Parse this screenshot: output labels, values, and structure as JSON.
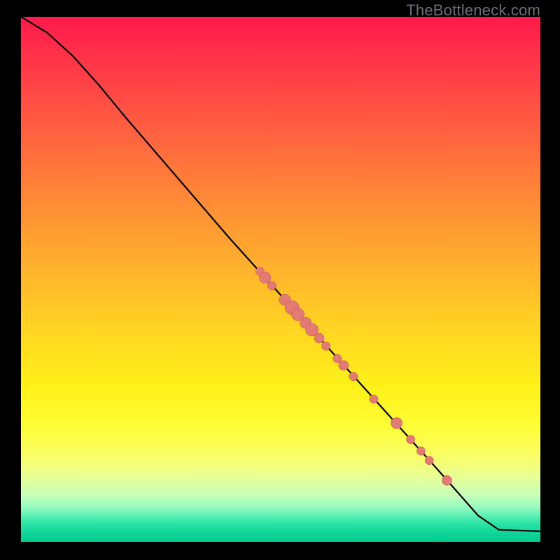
{
  "watermark": "TheBottleneck.com",
  "colors": {
    "background": "#000000",
    "line": "#000000",
    "point_fill": "#e47a74",
    "point_stroke": "#c65b58",
    "watermark": "#6b6e74"
  },
  "chart_data": {
    "type": "line",
    "title": "",
    "xlabel": "",
    "ylabel": "",
    "xlim": [
      0,
      100
    ],
    "ylim": [
      0,
      100
    ],
    "grid": false,
    "line": [
      {
        "x": 0,
        "y": 100
      },
      {
        "x": 5,
        "y": 97
      },
      {
        "x": 10,
        "y": 92.5
      },
      {
        "x": 15,
        "y": 87
      },
      {
        "x": 20,
        "y": 81
      },
      {
        "x": 30,
        "y": 69.5
      },
      {
        "x": 40,
        "y": 58
      },
      {
        "x": 50,
        "y": 47
      },
      {
        "x": 60,
        "y": 36
      },
      {
        "x": 70,
        "y": 25
      },
      {
        "x": 80,
        "y": 14
      },
      {
        "x": 88,
        "y": 5
      },
      {
        "x": 92,
        "y": 2.3
      },
      {
        "x": 100,
        "y": 2
      }
    ],
    "points": [
      {
        "x": 46.0,
        "y": 51.5,
        "size": 6
      },
      {
        "x": 47.0,
        "y": 50.3,
        "size": 8
      },
      {
        "x": 48.3,
        "y": 48.8,
        "size": 6
      },
      {
        "x": 50.8,
        "y": 46.1,
        "size": 8
      },
      {
        "x": 52.2,
        "y": 44.6,
        "size": 10
      },
      {
        "x": 53.3,
        "y": 43.3,
        "size": 9
      },
      {
        "x": 54.8,
        "y": 41.7,
        "size": 8
      },
      {
        "x": 56.0,
        "y": 40.4,
        "size": 9
      },
      {
        "x": 57.4,
        "y": 38.8,
        "size": 7
      },
      {
        "x": 58.7,
        "y": 37.3,
        "size": 6
      },
      {
        "x": 60.9,
        "y": 34.9,
        "size": 6
      },
      {
        "x": 62.1,
        "y": 33.6,
        "size": 7
      },
      {
        "x": 64.0,
        "y": 31.5,
        "size": 6
      },
      {
        "x": 67.9,
        "y": 27.2,
        "size": 6
      },
      {
        "x": 72.3,
        "y": 22.6,
        "size": 8
      },
      {
        "x": 75.0,
        "y": 19.5,
        "size": 6
      },
      {
        "x": 77.0,
        "y": 17.3,
        "size": 6
      },
      {
        "x": 78.6,
        "y": 15.5,
        "size": 6
      },
      {
        "x": 82.0,
        "y": 11.7,
        "size": 7
      }
    ]
  }
}
